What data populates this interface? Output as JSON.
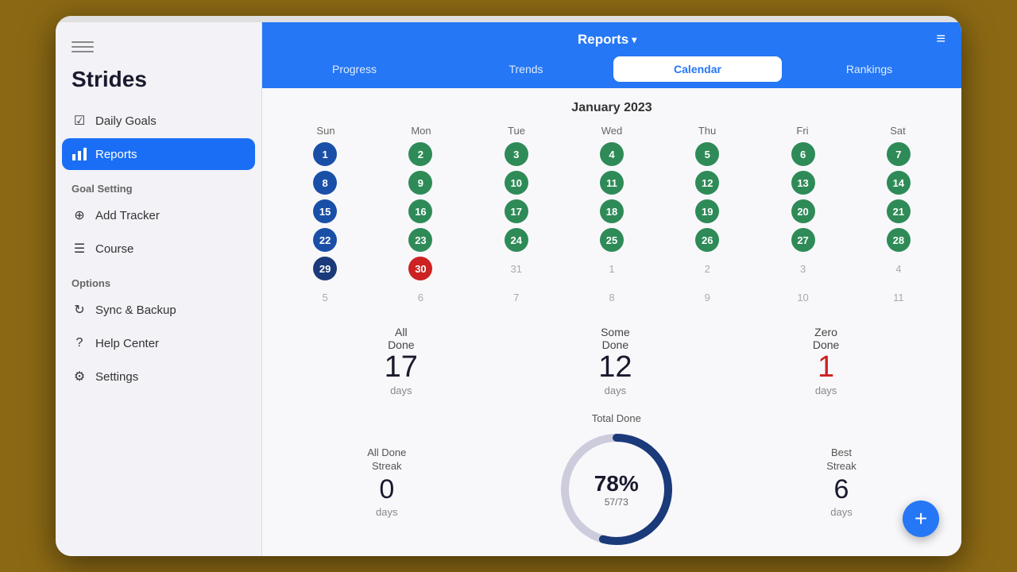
{
  "app": {
    "title": "Strides",
    "toggle_icon": "☰"
  },
  "header": {
    "title": "Reports",
    "chevron": "▾",
    "menu_icon": "≡"
  },
  "tabs": [
    {
      "id": "progress",
      "label": "Progress",
      "active": false
    },
    {
      "id": "trends",
      "label": "Trends",
      "active": false
    },
    {
      "id": "calendar",
      "label": "Calendar",
      "active": true
    },
    {
      "id": "rankings",
      "label": "Rankings",
      "active": false
    }
  ],
  "sidebar": {
    "daily_goals_label": "Daily Goals",
    "reports_label": "Reports",
    "goal_setting_section": "Goal Setting",
    "add_tracker_label": "Add Tracker",
    "course_label": "Course",
    "options_section": "Options",
    "sync_label": "Sync & Backup",
    "help_label": "Help Center",
    "settings_label": "Settings"
  },
  "calendar": {
    "month": "January 2023",
    "day_headers": [
      "Sun",
      "Mon",
      "Tue",
      "Wed",
      "Thu",
      "Fri",
      "Sat"
    ],
    "days": [
      {
        "date": "1",
        "color": "blue",
        "row": 0,
        "col": 0
      },
      {
        "date": "2",
        "color": "green",
        "row": 0,
        "col": 1
      },
      {
        "date": "3",
        "color": "green",
        "row": 0,
        "col": 2
      },
      {
        "date": "4",
        "color": "green",
        "row": 0,
        "col": 3
      },
      {
        "date": "5",
        "color": "green",
        "row": 0,
        "col": 4
      },
      {
        "date": "6",
        "color": "green",
        "row": 0,
        "col": 5
      },
      {
        "date": "7",
        "color": "green",
        "row": 0,
        "col": 6
      },
      {
        "date": "8",
        "color": "blue",
        "row": 1,
        "col": 0
      },
      {
        "date": "9",
        "color": "green",
        "row": 1,
        "col": 1
      },
      {
        "date": "10",
        "color": "green",
        "row": 1,
        "col": 2
      },
      {
        "date": "11",
        "color": "green",
        "row": 1,
        "col": 3
      },
      {
        "date": "12",
        "color": "green",
        "row": 1,
        "col": 4
      },
      {
        "date": "13",
        "color": "green",
        "row": 1,
        "col": 5
      },
      {
        "date": "14",
        "color": "green",
        "row": 1,
        "col": 6
      },
      {
        "date": "15",
        "color": "blue",
        "row": 2,
        "col": 0
      },
      {
        "date": "16",
        "color": "green",
        "row": 2,
        "col": 1
      },
      {
        "date": "17",
        "color": "green",
        "row": 2,
        "col": 2
      },
      {
        "date": "18",
        "color": "green",
        "row": 2,
        "col": 3
      },
      {
        "date": "19",
        "color": "green",
        "row": 2,
        "col": 4
      },
      {
        "date": "20",
        "color": "green",
        "row": 2,
        "col": 5
      },
      {
        "date": "21",
        "color": "green",
        "row": 2,
        "col": 6
      },
      {
        "date": "22",
        "color": "blue",
        "row": 3,
        "col": 0
      },
      {
        "date": "23",
        "color": "green",
        "row": 3,
        "col": 1
      },
      {
        "date": "24",
        "color": "green",
        "row": 3,
        "col": 2
      },
      {
        "date": "25",
        "color": "green",
        "row": 3,
        "col": 3
      },
      {
        "date": "26",
        "color": "green",
        "row": 3,
        "col": 4
      },
      {
        "date": "27",
        "color": "green",
        "row": 3,
        "col": 5
      },
      {
        "date": "28",
        "color": "green",
        "row": 3,
        "col": 6
      },
      {
        "date": "29",
        "color": "dark-blue",
        "row": 4,
        "col": 0
      },
      {
        "date": "30",
        "color": "red",
        "row": 4,
        "col": 1
      },
      {
        "date": "31",
        "color": "empty",
        "row": 4,
        "col": 2
      },
      {
        "date": "1",
        "color": "empty",
        "row": 4,
        "col": 3
      },
      {
        "date": "2",
        "color": "empty",
        "row": 4,
        "col": 4
      },
      {
        "date": "3",
        "color": "empty",
        "row": 4,
        "col": 5
      },
      {
        "date": "4",
        "color": "empty",
        "row": 4,
        "col": 6
      },
      {
        "date": "5",
        "color": "empty",
        "row": 5,
        "col": 0
      },
      {
        "date": "6",
        "color": "empty",
        "row": 5,
        "col": 1
      },
      {
        "date": "7",
        "color": "empty",
        "row": 5,
        "col": 2
      },
      {
        "date": "8",
        "color": "empty",
        "row": 5,
        "col": 3
      },
      {
        "date": "9",
        "color": "empty",
        "row": 5,
        "col": 4
      },
      {
        "date": "10",
        "color": "empty",
        "row": 5,
        "col": 5
      },
      {
        "date": "11",
        "color": "empty",
        "row": 5,
        "col": 6
      }
    ]
  },
  "stats": {
    "all_done_label": "All Done",
    "all_done_sub": "days",
    "all_done_value": "17",
    "some_done_label": "Some Done",
    "some_done_sub": "days",
    "some_done_value": "12",
    "zero_done_label": "Zero Done",
    "zero_done_sub": "days",
    "zero_done_value": "1"
  },
  "bottom_stats": {
    "all_done_streak_label1": "All Done",
    "all_done_streak_label2": "Streak",
    "all_done_streak_value": "0",
    "all_done_streak_unit": "days",
    "total_done_title": "Total Done",
    "total_done_percent": "78%",
    "total_done_fraction": "57/73",
    "best_streak_label1": "Best",
    "best_streak_label2": "Streak",
    "best_streak_value": "6",
    "best_streak_unit": "days"
  },
  "donut": {
    "percent": 78,
    "stroke_color": "#1a3a7a",
    "bg_color": "#ccccdd"
  },
  "fab": {
    "icon": "+"
  }
}
